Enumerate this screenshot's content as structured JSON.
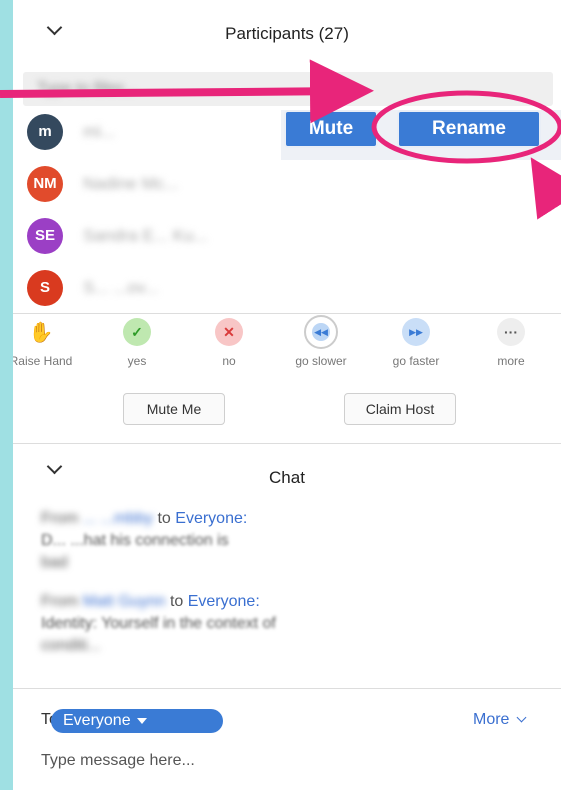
{
  "participants": {
    "title": "Participants (27)",
    "search_placeholder": "Type to filter...",
    "mute_label": "Mute",
    "rename_label": "Rename",
    "list": [
      {
        "initials": "m",
        "name": "mi...",
        "color": "#34495e"
      },
      {
        "initials": "NM",
        "name": "Nadine Mc...",
        "color": "#e14b2c"
      },
      {
        "initials": "SE",
        "name": "Sandra E... Ku...",
        "color": "#9b3fc5"
      },
      {
        "initials": "S",
        "name": "S... ...ov...",
        "color": "#d93a1f"
      }
    ]
  },
  "reactions": [
    {
      "label": "Raise Hand",
      "icon": "raise-hand-icon"
    },
    {
      "label": "yes",
      "icon": "check-icon"
    },
    {
      "label": "no",
      "icon": "x-icon"
    },
    {
      "label": "go slower",
      "icon": "rewind-icon"
    },
    {
      "label": "go faster",
      "icon": "fast-forward-icon"
    },
    {
      "label": "more",
      "icon": "ellipsis-icon"
    }
  ],
  "actions": {
    "mute_me": "Mute Me",
    "claim_host": "Claim Host"
  },
  "chat": {
    "title": "Chat",
    "messages": [
      {
        "from_prefix": "From",
        "sender": "... ...mbby",
        "to": "to",
        "recipient": "Everyone:",
        "body1": "D... ...hat his connection is",
        "body2": "bad"
      },
      {
        "from_prefix": "From",
        "sender": "Matt Guynn",
        "to": "to",
        "recipient": "Everyone:",
        "body1": "Identity: Yourself in the context of",
        "body2": "conditi..."
      }
    ],
    "to_label": "To:",
    "recipient_select": "Everyone",
    "more_label": "More",
    "input_placeholder": "Type message here..."
  },
  "colors": {
    "accent": "#3a7bd5",
    "annotation": "#e8257a",
    "frame": "#9fe0e3"
  }
}
